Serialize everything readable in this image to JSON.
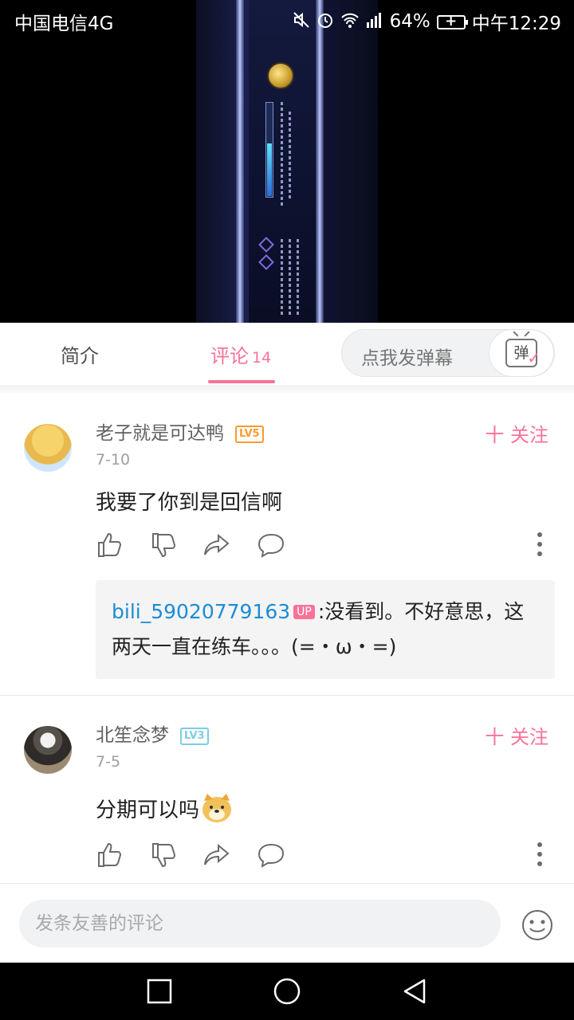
{
  "status_bar": {
    "carrier": "中国电信4G",
    "battery": "64%",
    "time": "中午12:29",
    "icons": [
      "mute-icon",
      "alarm-icon",
      "wifi-icon",
      "signal-icon",
      "battery-icon"
    ]
  },
  "video": {
    "description_icon": "video-frame"
  },
  "tabs": {
    "intro": "简介",
    "comments": "评论",
    "comments_count": "14",
    "danmaku_placeholder": "点我发弹幕",
    "danmaku_button": "弹"
  },
  "comments": [
    {
      "user": "老子就是可达鸭",
      "level": "LV5",
      "date": "7-10",
      "text": "我要了你到是回信啊",
      "follow": "十 关注",
      "reply": {
        "user": "bili_59020779163",
        "badge": "UP",
        "text": ":没看到。不好意思，这两天一直在练车。。。(=・ω・=)"
      }
    },
    {
      "user": "北笙念梦",
      "level": "LV3",
      "date": "7-5",
      "text": "分期可以吗",
      "follow": "十 关注"
    }
  ],
  "input": {
    "placeholder": "发条友善的评论"
  },
  "colors": {
    "accent": "#fb7299",
    "reply_user": "#1c8bd6"
  }
}
